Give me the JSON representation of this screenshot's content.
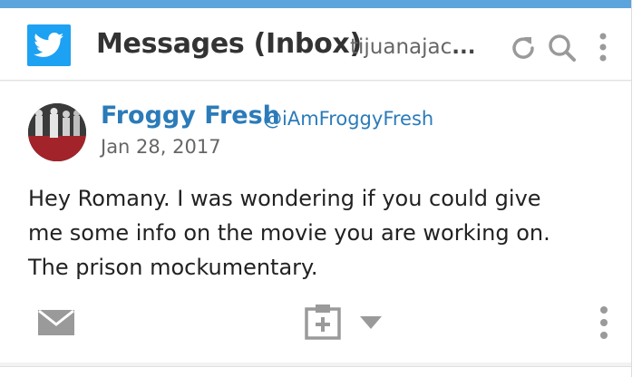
{
  "header": {
    "network_icon": "twitter-icon",
    "title": "Messages (Inbox)",
    "account": "tijuanajac",
    "account_ellipsis": "...",
    "actions": [
      "refresh-icon",
      "search-icon",
      "more-options-icon"
    ]
  },
  "message": {
    "author_name": "Froggy Fresh",
    "author_handle": "@iAmFroggyFresh",
    "date": "Jan 28, 2017",
    "lines": [
      "Hey Romany. I was wondering if you could give",
      "me some info on the movie you are working on.",
      "The prison mockumentary."
    ],
    "actions": [
      "reply-envelope-icon",
      "assign-task-icon",
      "chevron-down-icon",
      "more-options-icon"
    ]
  },
  "colors": {
    "accent_bar": "#5ca4dc",
    "twitter_blue": "#1da1f2",
    "link_blue": "#2b7bb9",
    "icon_gray": "#9a9a9a"
  }
}
